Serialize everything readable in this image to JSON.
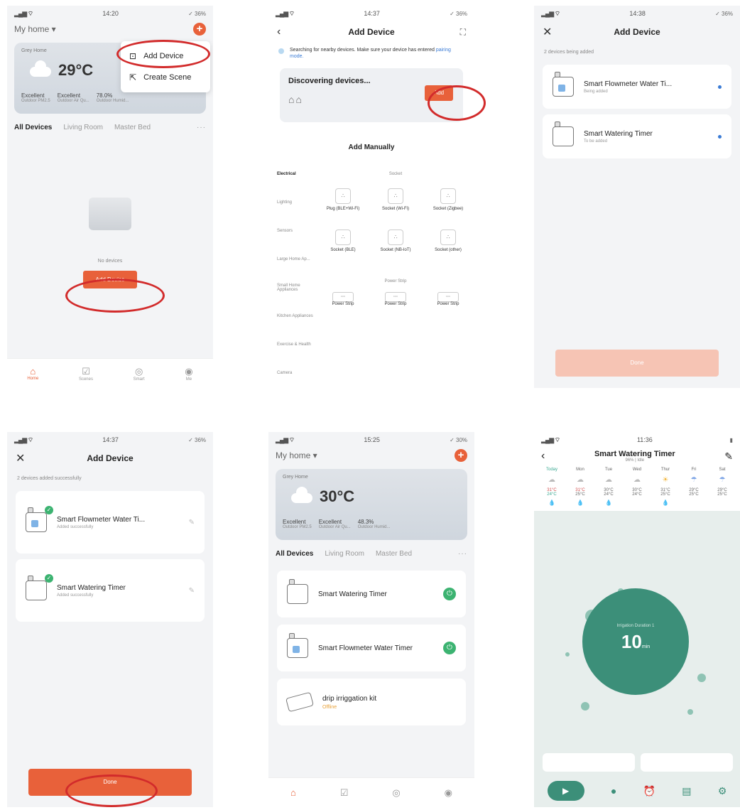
{
  "screen1": {
    "time": "14:20",
    "battery": "✓ 36%",
    "home_name": "My home ▾",
    "weather_loc": "Grey Home",
    "temperature": "29°C",
    "metrics": [
      {
        "value": "Excellent",
        "label": "Outdoor PM2.5"
      },
      {
        "value": "Excellent",
        "label": "Outdoor Air Qu..."
      },
      {
        "value": "78.0%",
        "label": "Outdoor Humid..."
      }
    ],
    "menu": [
      {
        "icon": "⊡",
        "label": "Add Device"
      },
      {
        "icon": "⇱",
        "label": "Create Scene"
      }
    ],
    "tabs": [
      "All Devices",
      "Living Room",
      "Master Bed"
    ],
    "tabs_more": "···",
    "no_devices": "No devices",
    "add_device_btn": "Add Device",
    "tabbar": [
      "Home",
      "Scenes",
      "Smart",
      "Me"
    ]
  },
  "screen2": {
    "time": "14:37",
    "battery": "✓ 36%",
    "title": "Add Device",
    "scan_msg": "Searching for nearby devices. Make sure your device has entered",
    "scan_link": "pairing mode.",
    "discovering": "Discovering devices...",
    "add_btn": "Add",
    "add_manually": "Add Manually",
    "categories": [
      "Electrical",
      "Lighting",
      "Sensors",
      "Large Home Ap...",
      "Small Home Appliances",
      "Kitchen Appliances",
      "Exercise & Health",
      "Camera"
    ],
    "section_socket": "Socket",
    "sockets_row1": [
      "",
      "",
      ""
    ],
    "sockets_row1_labels": [
      "Plug (BLE+Wi-Fi)",
      "Socket (Wi-Fi)",
      "Socket (Zigbee)"
    ],
    "sockets_row2_labels": [
      "Socket (BLE)",
      "Socket (NB-IoT)",
      "Socket (other)"
    ],
    "section_strip": "Power Strip",
    "strip_labels": [
      "Power Strip",
      "Power Strip",
      "Power Strip"
    ]
  },
  "screen3": {
    "time": "14:38",
    "battery": "✓ 36%",
    "title": "Add Device",
    "sublabel": "2 devices being added",
    "devices": [
      {
        "name": "Smart Flowmeter Water Ti...",
        "status": "Being added"
      },
      {
        "name": "Smart Watering Timer",
        "status": "To be added"
      }
    ],
    "done": "Done"
  },
  "screen4": {
    "time": "14:37",
    "battery": "✓ 36%",
    "title": "Add Device",
    "sublabel": "2 devices added successfully",
    "devices": [
      {
        "name": "Smart Flowmeter Water Ti...",
        "status": "Added successfully"
      },
      {
        "name": "Smart Watering Timer",
        "status": "Added successfully"
      }
    ],
    "done": "Done"
  },
  "screen5": {
    "time": "15:25",
    "battery": "✓ 30%",
    "home_name": "My home ▾",
    "weather_loc": "Grey Home",
    "temperature": "30°C",
    "metrics": [
      {
        "value": "Excellent",
        "label": "Outdoor PM2.5"
      },
      {
        "value": "Excellent",
        "label": "Outdoor Air Qu..."
      },
      {
        "value": "48.3%",
        "label": "Outdoor Humid..."
      }
    ],
    "tabs": [
      "All Devices",
      "Living Room",
      "Master Bed"
    ],
    "tabs_more": "···",
    "devices": [
      {
        "name": "Smart Watering Timer"
      },
      {
        "name": "Smart Flowmeter Water Timer"
      }
    ],
    "kit_name": "drip irriggation kit",
    "kit_status": "Offline"
  },
  "screen6": {
    "time": "11:36",
    "title": "Smart Watering Timer",
    "subtitle": "96% | Idle",
    "days": [
      {
        "label": "Today",
        "hi": "31°C",
        "lo": "24°C",
        "rain": true
      },
      {
        "label": "Mon",
        "hi": "31°C",
        "lo": "25°C",
        "rain": true
      },
      {
        "label": "Tue",
        "hi": "30°C",
        "lo": "24°C",
        "rain": true
      },
      {
        "label": "Wed",
        "hi": "30°C",
        "lo": "24°C",
        "rain": false
      },
      {
        "label": "Thur",
        "hi": "31°C",
        "lo": "25°C",
        "rain": true
      },
      {
        "label": "Fri",
        "hi": "29°C",
        "lo": "25°C",
        "rain": false
      },
      {
        "label": "Sat",
        "hi": "29°C",
        "lo": "25°C",
        "rain": false
      }
    ],
    "circle_label": "Irrigation Duration 1",
    "circle_value": "10",
    "circle_unit": "min"
  }
}
